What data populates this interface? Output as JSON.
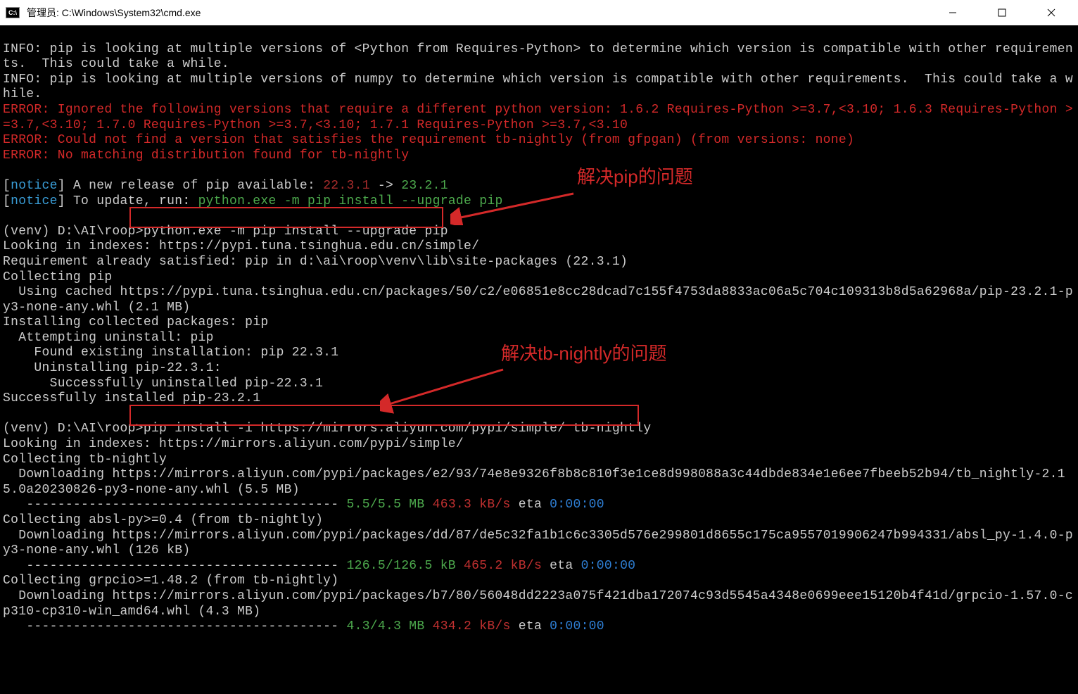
{
  "titlebar": {
    "icon_text": "C:\\",
    "title": "管理员: C:\\Windows\\System32\\cmd.exe"
  },
  "lines": {
    "info1": "INFO: pip is looking at multiple versions of <Python from Requires-Python> to determine which version is compatible with other requirements.  This could take a while.",
    "info2": "INFO: pip is looking at multiple versions of numpy to determine which version is compatible with other requirements.  This could take a while.",
    "err1": "ERROR: Ignored the following versions that require a different python version: 1.6.2 Requires-Python >=3.7,<3.10; 1.6.3 Requires-Python >=3.7,<3.10; 1.7.0 Requires-Python >=3.7,<3.10; 1.7.1 Requires-Python >=3.7,<3.10",
    "err2": "ERROR: Could not find a version that satisfies the requirement tb-nightly (from gfpgan) (from versions: none)",
    "err3": "ERROR: No matching distribution found for tb-nightly",
    "notice_open": "[",
    "notice_label": "notice",
    "notice_close1": "] A new release of pip available: ",
    "notice_v1": "22.3.1",
    "notice_arrow": " -> ",
    "notice_v2": "23.2.1",
    "notice_close2": "] To update, run: ",
    "notice_cmd": "python.exe -m pip install --upgrade pip",
    "prompt1": "(venv) D:\\AI\\roop>",
    "cmd1": "python.exe -m pip install --upgrade pip",
    "looking1": "Looking in indexes: https://pypi.tuna.tsinghua.edu.cn/simple/",
    "req_satisfied": "Requirement already satisfied: pip in d:\\ai\\roop\\venv\\lib\\site-packages (22.3.1)",
    "collecting_pip": "Collecting pip",
    "cached": "  Using cached https://pypi.tuna.tsinghua.edu.cn/packages/50/c2/e06851e8cc28dcad7c155f4753da8833ac06a5c704c109313b8d5a62968a/pip-23.2.1-py3-none-any.whl (2.1 MB)",
    "installing": "Installing collected packages: pip",
    "attempt": "  Attempting uninstall: pip",
    "found_existing": "    Found existing installation: pip 22.3.1",
    "uninstalling": "    Uninstalling pip-22.3.1:",
    "uninstalled": "      Successfully uninstalled pip-22.3.1",
    "installed_ok": "Successfully installed pip-23.2.1",
    "cmd2": "pip install -i https://mirrors.aliyun.com/pypi/simple/ tb-nightly",
    "looking2": "Looking in indexes: https://mirrors.aliyun.com/pypi/simple/",
    "collect_tb": "Collecting tb-nightly",
    "download_tb": "  Downloading https://mirrors.aliyun.com/pypi/packages/e2/93/74e8e9326f8b8c810f3e1ce8d998088a3c44dbde834e1e6ee7fbeeb52b94/tb_nightly-2.15.0a20230826-py3-none-any.whl (5.5 MB)",
    "prog1_bar": "   ---------------------------------------- ",
    "prog1_mb": "5.5/5.5 MB",
    "prog1_speed": " 463.3 kB/s",
    "prog1_eta_lbl": " eta ",
    "prog1_eta": "0:00:00",
    "collect_absl": "Collecting absl-py>=0.4 (from tb-nightly)",
    "download_absl": "  Downloading https://mirrors.aliyun.com/pypi/packages/dd/87/de5c32fa1b1c6c3305d576e299801d8655c175ca9557019906247b994331/absl_py-1.4.0-py3-none-any.whl (126 kB)",
    "prog2_bar": "   ---------------------------------------- ",
    "prog2_mb": "126.5/126.5 kB",
    "prog2_speed": " 465.2 kB/s",
    "prog2_eta_lbl": " eta ",
    "prog2_eta": "0:00:00",
    "collect_grpc": "Collecting grpcio>=1.48.2 (from tb-nightly)",
    "download_grpc": "  Downloading https://mirrors.aliyun.com/pypi/packages/b7/80/56048dd2223a075f421dba172074c93d5545a4348e0699eee15120b4f41d/grpcio-1.57.0-cp310-cp310-win_amd64.whl (4.3 MB)",
    "prog3_bar": "   ---------------------------------------- ",
    "prog3_mb": "4.3/4.3 MB",
    "prog3_speed": " 434.2 kB/s",
    "prog3_eta_lbl": " eta ",
    "prog3_eta": "0:00:00"
  },
  "annotations": {
    "a1": "解决pip的问题",
    "a2": "解决tb-nightly的问题"
  }
}
